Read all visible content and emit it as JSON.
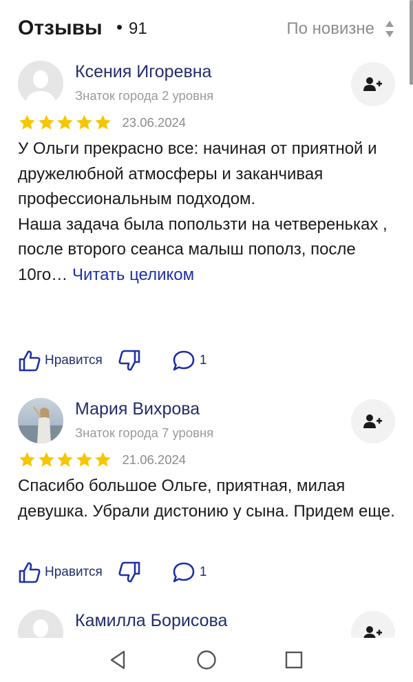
{
  "header": {
    "title": "Отзывы",
    "separator": "•",
    "count": "91",
    "sort_label": "По новизне",
    "sort_icon": "sort-arrows-icon"
  },
  "follow_icon": "add-user-icon",
  "reviews": [
    {
      "name": "Ксения Игоревна",
      "level": "Знаток города 2 уровня",
      "rating": 5,
      "date": "23.06.2024",
      "text": [
        "У Ольги прекрасно все: начиная от приятной и дружелюбной атмосферы и заканчивая профессиональным подходом.",
        "Наша задача была попользти на четвереньках , после второго сеанса малыш пополз, после 10го…"
      ],
      "read_more": "Читать целиком",
      "like_label": "Нравится",
      "comments_count": "1",
      "avatar": "placeholder"
    },
    {
      "name": "Мария Вихрова",
      "level": "Знаток города 7 уровня",
      "rating": 5,
      "date": "21.06.2024",
      "text": [
        "Спасибо большое Ольге, приятная, милая девушка. Убрали дистонию у сына. Придем еще."
      ],
      "read_more": "",
      "like_label": "Нравится",
      "comments_count": "1",
      "avatar": "photo"
    },
    {
      "name": "Камилла Борисова",
      "avatar": "placeholder"
    }
  ],
  "colors": {
    "star": "#f7c600",
    "name": "#222d6b",
    "link": "#1c2fa8",
    "muted": "#8c8c8c"
  },
  "navbar": {
    "back_icon": "triangle-back-icon",
    "home_icon": "circle-home-icon",
    "recents_icon": "square-recents-icon"
  }
}
